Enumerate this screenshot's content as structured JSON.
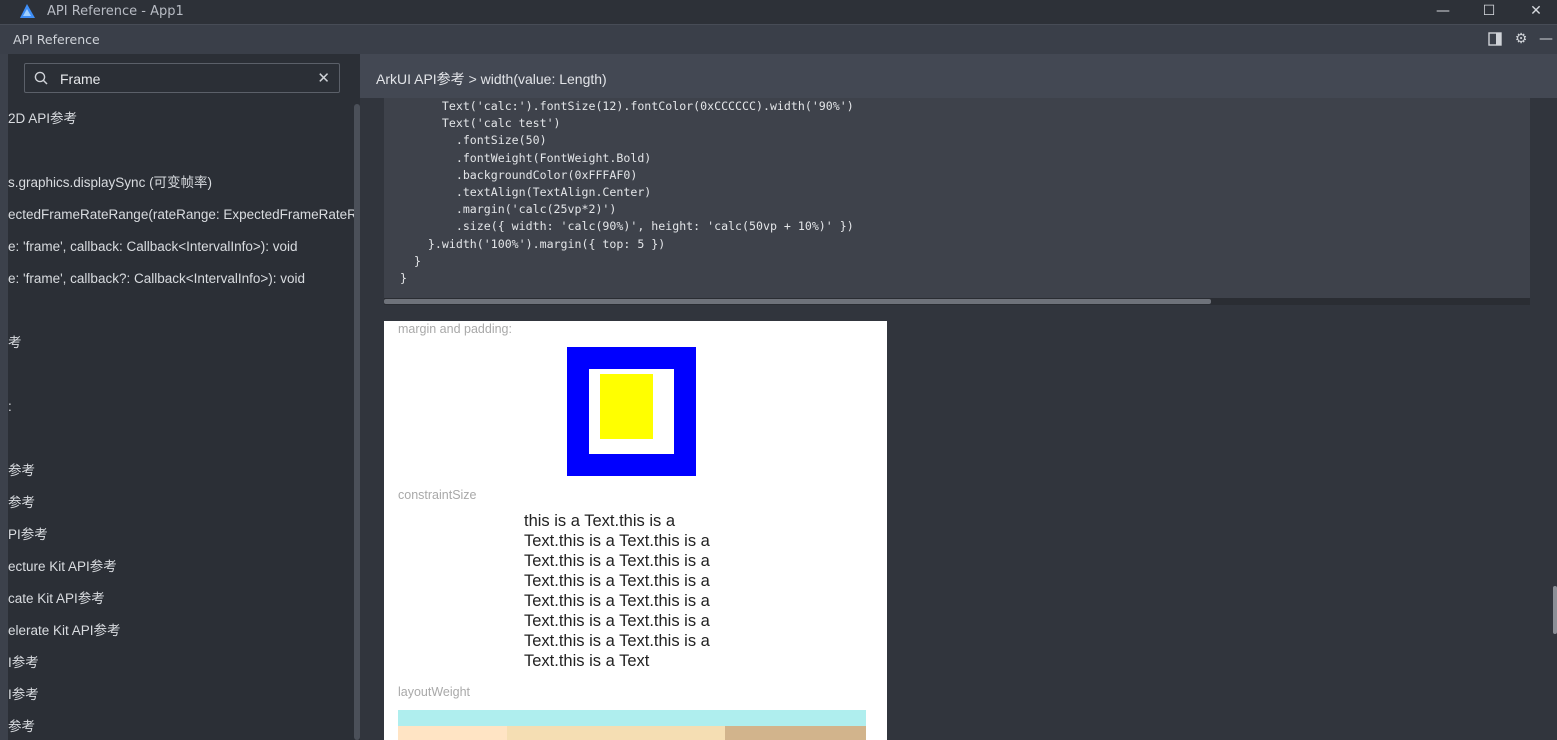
{
  "window": {
    "title": "API Reference - App1",
    "minimize_glyph": "—",
    "maximize_glyph": "☐",
    "close_glyph": "✕"
  },
  "panel": {
    "title": "API Reference",
    "tools": [
      "split-panel-icon",
      "gear-icon",
      "minimize-panel-icon"
    ]
  },
  "sidebar": {
    "search": {
      "value": "Frame",
      "placeholder": ""
    },
    "items": [
      "2D API参考",
      "s.graphics.displaySync (可变帧率)",
      "ectedFrameRateRange(rateRange: ExpectedFrameRateRange)",
      "e: 'frame', callback: Callback<IntervalInfo>): void",
      "e: 'frame', callback?: Callback<IntervalInfo>): void",
      "考",
      ":",
      "参考",
      "参考",
      "PI参考",
      "ecture Kit API参考",
      "cate Kit API参考",
      "elerate Kit API参考",
      "I参考",
      "I参考",
      "参考"
    ]
  },
  "content": {
    "breadcrumb": "ArkUI API参考 > width(value: Length)",
    "code": "      Text('calc:').fontSize(12).fontColor(0xCCCCCC).width('90%')\n      Text('calc test')\n        .fontSize(50)\n        .fontWeight(FontWeight.Bold)\n        .backgroundColor(0xFFFAF0)\n        .textAlign(TextAlign.Center)\n        .margin('calc(25vp*2)')\n        .size({ width: 'calc(90%)', height: 'calc(50vp + 10%)' })\n    }.width('100%').margin({ top: 5 })\n  }\n}",
    "preview": {
      "label_margin": "margin and padding:",
      "label_constraint": "constraintSize",
      "constraint_text": "this is a Text.this is a Text.this is a Text.this is a Text.this is a Text.this is a Text.this is a Text.this is a Text.this is a Text.this is a Text.this is a Text.this is a Text.this is a Text.this is a Text.this is a Text",
      "label_layout": "layoutWeight"
    }
  },
  "colors": {
    "margin_outer": "#0000ff",
    "margin_inner": "#ffffff",
    "padding_content": "#ffff00",
    "layout_bar": "#afeeee",
    "layout_cells": [
      "#ffe4c4",
      "#f5deb3",
      "#d2b48c"
    ]
  }
}
